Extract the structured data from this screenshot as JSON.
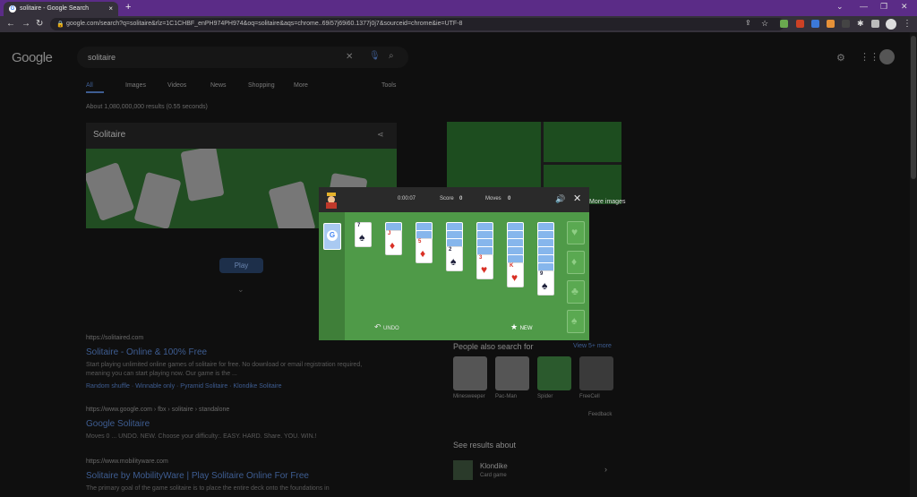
{
  "browser": {
    "tab_title": "solitaire - Google Search",
    "new_tab": "+",
    "url": "google.com/search?q=solitaire&rlz=1C1CHBF_enPH974PH974&oq=solitaire&aqs=chrome..69i57j69i60.1377j0j7&sourceid=chrome&ie=UTF-8",
    "accent": "#5b2c87"
  },
  "google": {
    "logo": "Google",
    "query": "solitaire",
    "tabs": [
      "All",
      "Images",
      "Videos",
      "News",
      "Shopping",
      "More",
      "Tools"
    ],
    "result_count": "About 1,080,000,000 results (0.55 seconds)",
    "card_title": "Solitaire",
    "play_label": "Play",
    "results": [
      {
        "url": "https://solitaired.com",
        "title": "Solitaire - Online & 100% Free",
        "snippet": "Start playing unlimited online games of solitaire for free. No download or email registration required, meaning you can start playing now. Our game is the ...",
        "links": "Random shuffle · Winnable only · Pyramid Solitaire · Klondike Solitaire"
      },
      {
        "url": "https://www.google.com › fbx › solitaire › standalone",
        "title": "Google Solitaire",
        "snippet": "Moves 0 ... UNDO. NEW. Choose your difficulty:. EASY. HARD. Share. YOU. WIN.!"
      },
      {
        "url": "https://www.mobilityware.com",
        "title": "Solitaire by MobilityWare | Play Solitaire Online For Free",
        "snippet": "The primary goal of the game solitaire is to place the entire deck onto the foundations in"
      }
    ],
    "more_images": "More images",
    "people_also_search": "People also search for",
    "view_more": "View 5+ more",
    "related": [
      "Minesweeper",
      "Pac-Man",
      "Spider",
      "FreeCell"
    ],
    "feedback": "Feedback",
    "see_results_about": "See results about",
    "klondike": "Klondike",
    "klondike_sub": "Card game"
  },
  "game": {
    "timer": "0:00:07",
    "score_label": "Score",
    "score": "0",
    "moves_label": "Moves",
    "moves": "0",
    "undo_label": "UNDO",
    "new_label": "NEW",
    "stock_logo": "G",
    "tableau": [
      {
        "backs": 0,
        "rank": "7",
        "suit": "♠",
        "color": "blk"
      },
      {
        "backs": 1,
        "rank": "J",
        "suit": "♦",
        "color": "red"
      },
      {
        "backs": 2,
        "rank": "5",
        "suit": "♦",
        "color": "red"
      },
      {
        "backs": 3,
        "rank": "2",
        "suit": "♠",
        "color": "blk"
      },
      {
        "backs": 4,
        "rank": "3",
        "suit": "♥",
        "color": "red"
      },
      {
        "backs": 5,
        "rank": "K",
        "suit": "♥",
        "color": "red"
      },
      {
        "backs": 6,
        "rank": "9",
        "suit": "♠",
        "color": "blk"
      }
    ],
    "foundations": [
      "♥",
      "♦",
      "♣",
      "♠"
    ],
    "felt_color": "#4f9a48"
  }
}
